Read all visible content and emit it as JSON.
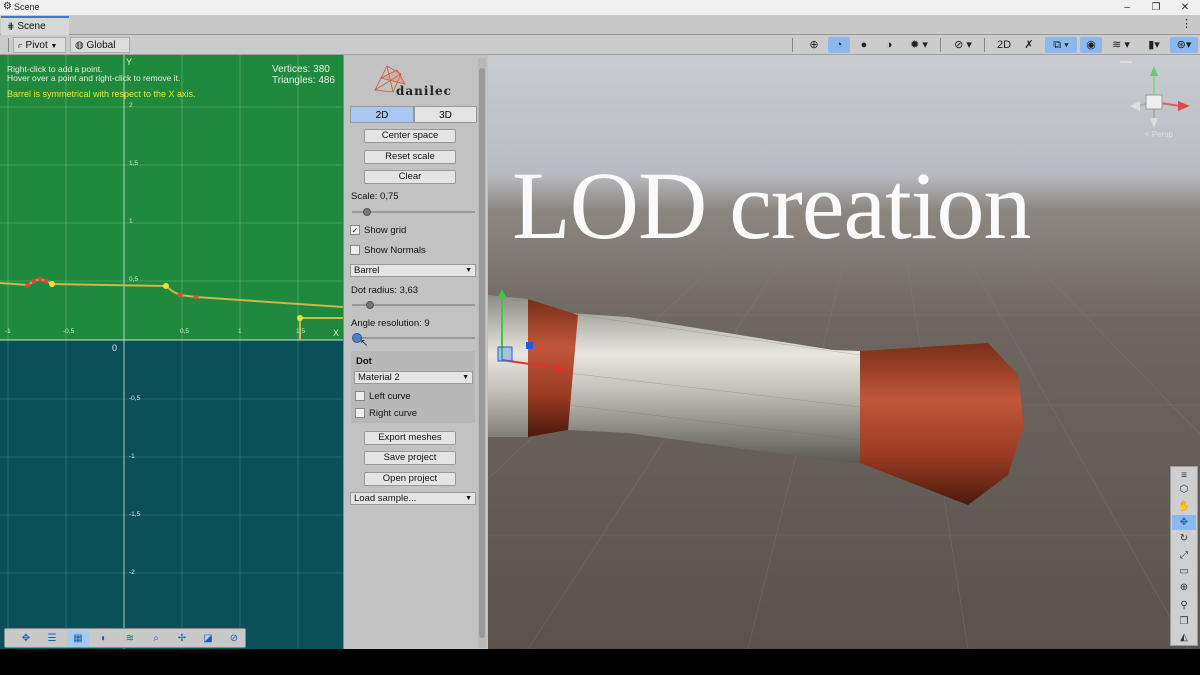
{
  "window": {
    "title": "Scene",
    "controls": [
      "–",
      "❐",
      "✕"
    ]
  },
  "tab": {
    "label": "Scene",
    "icon": "grid-icon",
    "menu_icon": "kebab-icon"
  },
  "toolbar": {
    "pivot_label": "Pivot",
    "global_label": "Global",
    "mode_2d": "2D"
  },
  "editor2d": {
    "help_line1": "Right-click to add a point.",
    "help_line2": "Hover over a point and right-click to remove it.",
    "symmetry_note": "Barrel is symmetrical with respect to the X axis.",
    "vertices": "Vertices: 380",
    "triangles": "Triangles: 486",
    "axis_y": "Y",
    "axis_x": "X",
    "origin": "0",
    "y_ticks": [
      "2",
      "1,5",
      "1",
      "0,5"
    ],
    "x_ticks": [
      "-1",
      "-0,5",
      "0,5",
      "1",
      "1,5"
    ],
    "neg_y_ticks": [
      "-0,5",
      "-1",
      "-1,5",
      "-2"
    ],
    "colors": {
      "top": "#1f8a3e",
      "bottom": "#0b4f59",
      "curve": "#c9b84a",
      "point_red": "#e0443a",
      "point_yellow": "#f2e02a"
    }
  },
  "panel": {
    "logo_text": "danilec",
    "seg_2d": "2D",
    "seg_3d": "3D",
    "center_space": "Center space",
    "reset_scale": "Reset scale",
    "clear": "Clear",
    "scale_label": "Scale: 0,75",
    "scale_value": 0.75,
    "show_grid": "Show grid",
    "show_grid_checked": true,
    "show_normals": "Show Normals",
    "show_normals_checked": false,
    "shape_value": "Barrel",
    "dot_radius_label": "Dot radius: 3,63",
    "angle_res_label": "Angle resolution: 9",
    "dot_header": "Dot",
    "material_value": "Material 2",
    "left_curve": "Left curve",
    "right_curve": "Right curve",
    "export_meshes": "Export meshes",
    "save_project": "Save project",
    "open_project": "Open project",
    "load_sample": "Load sample..."
  },
  "view3d": {
    "title": "LOD creation",
    "persp_label": "< Persp"
  }
}
